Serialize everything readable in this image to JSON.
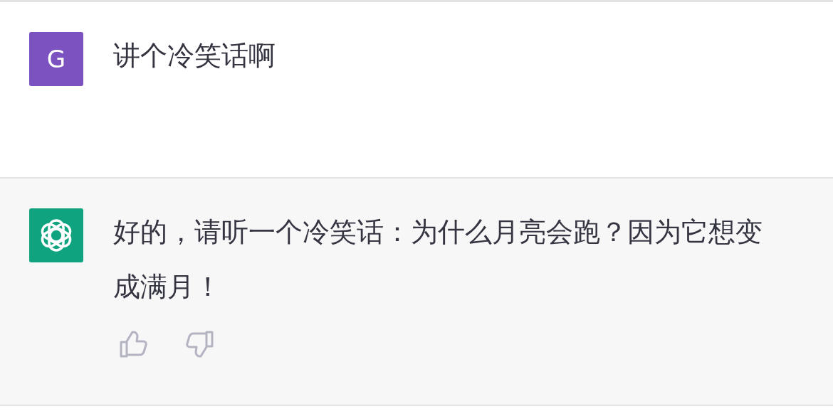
{
  "messages": [
    {
      "kind": "user",
      "avatar_letter": "G",
      "text": "讲个冷笑话啊"
    },
    {
      "kind": "assistant",
      "text": "好的，请听一个冷笑话：为什么月亮会跑？因为它想变成满月！"
    }
  ]
}
